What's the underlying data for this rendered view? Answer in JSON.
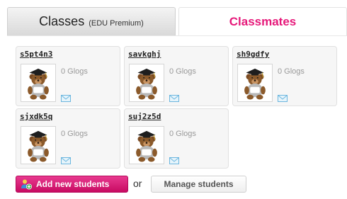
{
  "tabs": {
    "classes": {
      "label": "Classes",
      "sublabel": "(EDU Premium)"
    },
    "classmates": {
      "label": "Classmates",
      "color": "#e6197a"
    }
  },
  "students": [
    {
      "username": "s5pt4n3",
      "glogs": "0 Glogs",
      "avatar": "bear-graduate-icon"
    },
    {
      "username": "savkghj",
      "glogs": "0 Glogs",
      "avatar": "bear-graduate-icon"
    },
    {
      "username": "sh9gdfy",
      "glogs": "0 Glogs",
      "avatar": "bear-graduate-icon"
    },
    {
      "username": "sjxdk5q",
      "glogs": "0 Glogs",
      "avatar": "bear-graduate-icon"
    },
    {
      "username": "suj2z5d",
      "glogs": "0 Glogs",
      "avatar": "bear-graduate-icon"
    }
  ],
  "actions": {
    "add_label": "Add new students",
    "or_text": "or",
    "manage_label": "Manage students",
    "add_color": "#d1146f"
  }
}
